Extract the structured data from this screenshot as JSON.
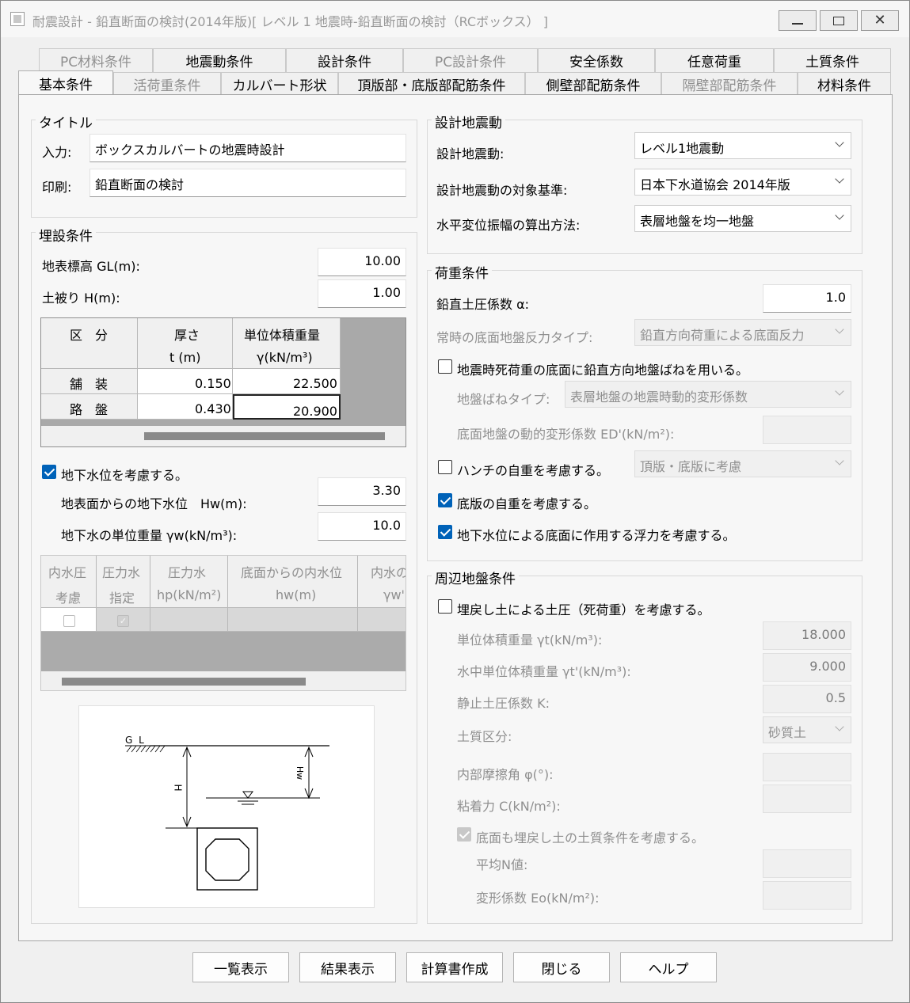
{
  "window": {
    "title": "耐震設計 - 鉛直断面の検討(2014年版)[ レベル 1 地震時-鉛直断面の検討（RCボックス） ]",
    "minimize_icon": "minimize-icon",
    "maximize_icon": "maximize-icon",
    "close_icon": "close-icon"
  },
  "tabs_row1": [
    {
      "label": "PC材料条件",
      "enabled": false
    },
    {
      "label": "地震動条件",
      "enabled": true
    },
    {
      "label": "設計条件",
      "enabled": true
    },
    {
      "label": "PC設計条件",
      "enabled": false
    },
    {
      "label": "安全係数",
      "enabled": true
    },
    {
      "label": "任意荷重",
      "enabled": true
    },
    {
      "label": "土質条件",
      "enabled": true
    }
  ],
  "tabs_row2": [
    {
      "label": "基本条件",
      "enabled": true,
      "active": true
    },
    {
      "label": "活荷重条件",
      "enabled": false
    },
    {
      "label": "カルバート形状",
      "enabled": true
    },
    {
      "label": "頂版部・底版部配筋条件",
      "enabled": true
    },
    {
      "label": "側壁部配筋条件",
      "enabled": true
    },
    {
      "label": "隔壁部配筋条件",
      "enabled": false
    },
    {
      "label": "材料条件",
      "enabled": true
    }
  ],
  "title_group": {
    "label": "タイトル",
    "input_label": "入力:",
    "input_value": "ボックスカルバートの地震時設計",
    "print_label": "印刷:",
    "print_value": "鉛直断面の検討"
  },
  "burial": {
    "label": "埋設条件",
    "gl_label": "地表標高 GL(m):",
    "gl_value": "10.00",
    "cover_label": "土被り H(m):",
    "cover_value": "1.00",
    "table": {
      "h_category": "区　分",
      "h_thickness": "厚さ",
      "h_thickness_unit": "t (m)",
      "h_weight": "単位体積重量",
      "h_weight_unit": "γ(kN/m³)",
      "rows": [
        {
          "name": "舗　装",
          "t": "0.150",
          "w": "22.500"
        },
        {
          "name": "路　盤",
          "t": "0.430",
          "w": "20.900"
        }
      ]
    },
    "gw_check_label": "地下水位を考慮する。",
    "gw_level_label": "地表面からの地下水位　Hw(m):",
    "gw_level_value": "3.30",
    "gw_weight_label": "地下水の単位重量 γw(kN/m³):",
    "gw_weight_value": "10.0",
    "inner_table": {
      "h1a": "内水圧",
      "h1b": "考慮",
      "h2a": "圧力水",
      "h2b": "指定",
      "h3a": "圧力水",
      "h3b": "hp(kN/m²)",
      "h4a": "底面からの内水位",
      "h4b": "hw(m)",
      "h5a": "内水の",
      "h5b": "γw'("
    }
  },
  "diagram": {
    "gl_label": "G L",
    "h_label": "H",
    "hw_label": "Hw"
  },
  "seismic": {
    "label": "設計地震動",
    "motion_label": "設計地震動:",
    "motion_value": "レベル1地震動",
    "standard_label": "設計地震動の対象基準:",
    "standard_value": "日本下水道協会 2014年版",
    "method_label": "水平変位振幅の算出方法:",
    "method_value": "表層地盤を均一地盤"
  },
  "load": {
    "label": "荷重条件",
    "alpha_label": "鉛直土圧係数 α:",
    "alpha_value": "1.0",
    "reaction_label": "常時の底面地盤反力タイプ:",
    "reaction_value": "鉛直方向荷重による底面反力",
    "spring_check_label": "地震時死荷重の底面に鉛直方向地盤ばねを用いる。",
    "spring_type_label": "地盤ばねタイプ:",
    "spring_type_value": "表層地盤の地震時動的変形係数",
    "ed_label": "底面地盤の動的変形係数 ED'(kN/m²):",
    "haunch_check_label": "ハンチの自重を考慮する。",
    "haunch_value": "頂版・底版に考慮",
    "bottom_check_label": "底版の自重を考慮する。",
    "buoyancy_check_label": "地下水位による底面に作用する浮力を考慮する。"
  },
  "ground": {
    "label": "周辺地盤条件",
    "backfill_check_label": "埋戻し土による土圧（死荷重）を考慮する。",
    "gamma_label": "単位体積重量 γt(kN/m³):",
    "gamma_value": "18.000",
    "gamma_sub_label": "水中単位体積重量 γt'(kN/m³):",
    "gamma_sub_value": "9.000",
    "k_label": "静止土圧係数 K:",
    "k_value": "0.5",
    "soil_label": "土質区分:",
    "soil_value": "砂質土",
    "phi_label": "内部摩擦角 φ(°):",
    "c_label": "粘着力 C(kN/m²):",
    "bottom_check_label": "底面も埋戻し土の土質条件を考慮する。",
    "n_label": "平均N値:",
    "eo_label": "変形係数 Eo(kN/m²):"
  },
  "buttons": {
    "list": "一覧表示",
    "result": "結果表示",
    "report": "計算書作成",
    "close": "閉じる",
    "help": "ヘルプ"
  }
}
